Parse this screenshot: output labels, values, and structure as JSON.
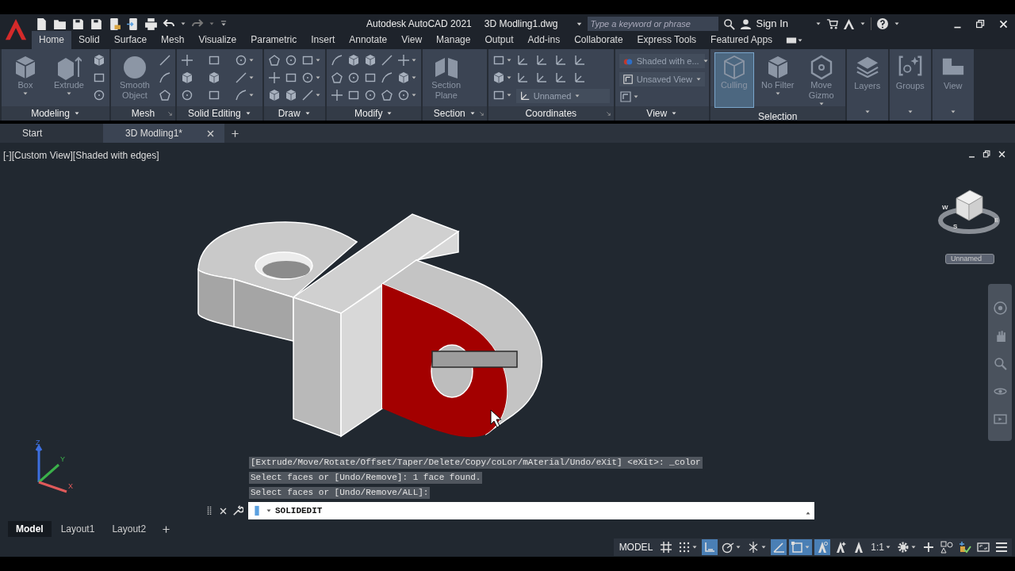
{
  "title_bar": {
    "app": "Autodesk AutoCAD 2021",
    "file": "3D Modling1.dwg",
    "search": {
      "placeholder": "Type a keyword or phrase"
    },
    "sign_in": "Sign In"
  },
  "ribbon_tabs": [
    {
      "label": "Home",
      "selected": true
    },
    {
      "label": "Solid",
      "selected": false
    },
    {
      "label": "Surface",
      "selected": false
    },
    {
      "label": "Mesh",
      "selected": false
    },
    {
      "label": "Visualize",
      "selected": false
    },
    {
      "label": "Parametric",
      "selected": false
    },
    {
      "label": "Insert",
      "selected": false
    },
    {
      "label": "Annotate",
      "selected": false
    },
    {
      "label": "View",
      "selected": false
    },
    {
      "label": "Manage",
      "selected": false
    },
    {
      "label": "Output",
      "selected": false
    },
    {
      "label": "Add-ins",
      "selected": false
    },
    {
      "label": "Collaborate",
      "selected": false
    },
    {
      "label": "Express Tools",
      "selected": false
    },
    {
      "label": "Featured Apps",
      "selected": false
    }
  ],
  "ribbon_panels": [
    {
      "label": "Modeling",
      "menu": true,
      "launcher": false,
      "tools": [
        {
          "kind": "big",
          "label": "Box",
          "caret": true,
          "selected": false
        },
        {
          "kind": "big",
          "label": "Extrude",
          "caret": true,
          "selected": false
        },
        {
          "kind": "column",
          "caret": false
        }
      ]
    },
    {
      "label": "Mesh",
      "menu": false,
      "launcher": true,
      "tools": [
        {
          "kind": "big",
          "label": "Smooth Object",
          "caret": false,
          "selected": false
        },
        {
          "kind": "column",
          "caret": false
        }
      ]
    },
    {
      "label": "Solid Editing",
      "menu": true,
      "launcher": false,
      "tools": [
        {
          "kind": "column",
          "caret": false
        },
        {
          "kind": "column",
          "caret": false
        },
        {
          "kind": "column",
          "caret": true
        }
      ]
    },
    {
      "label": "Draw",
      "menu": true,
      "launcher": false,
      "tools": [
        {
          "kind": "column",
          "caret": false
        },
        {
          "kind": "column",
          "caret": false
        },
        {
          "kind": "column",
          "caret": true
        }
      ]
    },
    {
      "label": "Modify",
      "menu": true,
      "launcher": false,
      "tools": [
        {
          "kind": "column",
          "caret": false
        },
        {
          "kind": "column",
          "caret": false
        },
        {
          "kind": "column",
          "caret": false
        },
        {
          "kind": "column",
          "caret": false
        },
        {
          "kind": "column",
          "caret": true
        }
      ]
    },
    {
      "label": "Section",
      "menu": true,
      "launcher": true,
      "tools": [
        {
          "kind": "big",
          "label": "Section Plane",
          "caret": false,
          "selected": false
        }
      ]
    },
    {
      "label": "Coordinates",
      "menu": false,
      "launcher": true,
      "tools": [
        {
          "kind": "column",
          "caret": true
        },
        {
          "kind": "block",
          "combo": "Unnamed"
        }
      ]
    },
    {
      "label": "View",
      "menu": true,
      "launcher": false,
      "tools": [
        {
          "kind": "combos",
          "items": [
            {
              "value": "Shaded with e..."
            },
            {
              "value": "Unsaved View"
            }
          ]
        }
      ]
    },
    {
      "label": "Selection",
      "menu": false,
      "launcher": false,
      "tools": [
        {
          "kind": "big",
          "label": "Culling",
          "caret": false,
          "selected": true
        },
        {
          "kind": "big",
          "label": "No Filter",
          "caret": true,
          "selected": false
        },
        {
          "kind": "big",
          "label": "Move Gizmo",
          "caret": true,
          "selected": false
        }
      ]
    }
  ],
  "collapsed_panels": [
    {
      "label": "Layers"
    },
    {
      "label": "Groups"
    },
    {
      "label": "View"
    }
  ],
  "file_tabs": [
    {
      "label": "Start",
      "selected": false,
      "closable": false
    },
    {
      "label": "3D Modling1*",
      "selected": true,
      "closable": true
    }
  ],
  "viewport": {
    "label": "[-][Custom View][Shaded with edges]",
    "compass": [
      "W",
      "S",
      "E"
    ],
    "ucs_menu": "Unnamed",
    "ucs_axes": [
      "Z",
      "Y",
      "X"
    ]
  },
  "command_history": [
    "[Extrude/Move/Rotate/Offset/Taper/Delete/Copy/coLor/mAterial/Undo/eXit] <eXit>: _color",
    "Select faces or [Undo/Remove]: 1 face found.",
    "Select faces or [Undo/Remove/ALL]:"
  ],
  "command_line": {
    "value": "SOLIDEDIT"
  },
  "layout_tabs": [
    {
      "label": "Model",
      "selected": true
    },
    {
      "label": "Layout1",
      "selected": false
    },
    {
      "label": "Layout2",
      "selected": false
    }
  ],
  "status_bar": {
    "space": "MODEL",
    "tools": [
      {
        "kind": "grid",
        "on": false,
        "menu": false
      },
      {
        "kind": "dots",
        "on": false,
        "menu": true
      },
      {
        "kind": "ortho",
        "on": true,
        "menu": false
      },
      {
        "kind": "polar",
        "on": false,
        "menu": true
      },
      {
        "kind": "iso",
        "on": false,
        "menu": true
      },
      {
        "kind": "angle",
        "on": true,
        "menu": false
      },
      {
        "kind": "selrect",
        "on": true,
        "menu": true
      },
      {
        "kind": "annot",
        "on": true,
        "menu": false
      },
      {
        "kind": "annot2",
        "on": false,
        "menu": false
      },
      {
        "kind": "annot3",
        "on": false,
        "menu": false
      },
      {
        "kind": "scale",
        "text": "1:1",
        "on": false,
        "menu": true
      },
      {
        "kind": "gear",
        "on": false,
        "menu": true
      },
      {
        "kind": "plus",
        "on": false,
        "menu": false
      },
      {
        "kind": "shapes",
        "on": false,
        "menu": false
      },
      {
        "kind": "hw",
        "on": false,
        "menu": false
      },
      {
        "kind": "fullscreen",
        "on": false,
        "menu": false
      },
      {
        "kind": "hamburger",
        "on": false,
        "menu": false
      }
    ]
  }
}
